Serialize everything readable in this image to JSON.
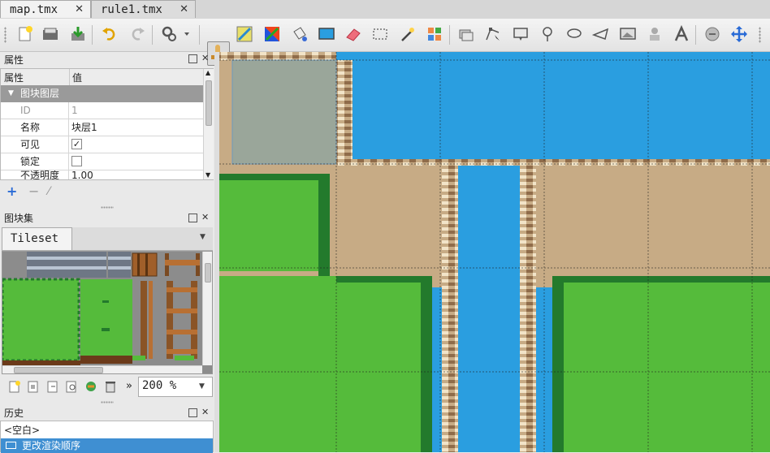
{
  "tabs": [
    {
      "label": "map.tmx",
      "active": true
    },
    {
      "label": "rule1.tmx",
      "active": false
    }
  ],
  "tab_close_glyph": "✕",
  "toolbar": {
    "icons": [
      "new-map-icon",
      "open-file-icon",
      "save-file-icon",
      "undo-icon",
      "redo-icon",
      "commands-icon",
      "stamp-brush-icon",
      "terrain-brush-icon",
      "random-mode-icon",
      "bucket-fill-icon",
      "shape-fill-icon",
      "eraser-icon",
      "rectangular-select-icon",
      "magic-wand-icon",
      "select-same-tile-icon",
      "select-objects-icon",
      "edit-polygons-icon",
      "insert-rectangle-icon",
      "insert-point-icon",
      "insert-ellipse-icon",
      "insert-polygon-icon",
      "insert-tile-icon",
      "insert-template-icon",
      "insert-text-icon",
      "flip-icon",
      "move-icon"
    ]
  },
  "properties_panel": {
    "title": "属性",
    "col_property": "属性",
    "col_value": "值",
    "group": "图块图层",
    "rows": [
      {
        "key": "ID",
        "value": "1",
        "disabled": true
      },
      {
        "key": "名称",
        "value": "块层1"
      },
      {
        "key": "可见",
        "checkbox": true,
        "checked": true,
        "value": "✓"
      },
      {
        "key": "锁定",
        "checkbox": true,
        "checked": false
      },
      {
        "key": "不透明度",
        "value": "1.00"
      }
    ]
  },
  "tileset_panel": {
    "title": "图块集",
    "tab": "Tileset",
    "zoom": "200 %",
    "more": "»"
  },
  "history_panel": {
    "title": "历史",
    "items": [
      {
        "label": "<空白>",
        "selected": false
      },
      {
        "label": "更改渲染顺序",
        "selected": true
      }
    ]
  },
  "colors": {
    "water": "#2a9ee0",
    "sand": "#c7ab85",
    "grass": "#55bb3b",
    "grass_dark": "#237a2c",
    "selection": "#9aa69a",
    "selected_row": "#3f8fd2"
  }
}
